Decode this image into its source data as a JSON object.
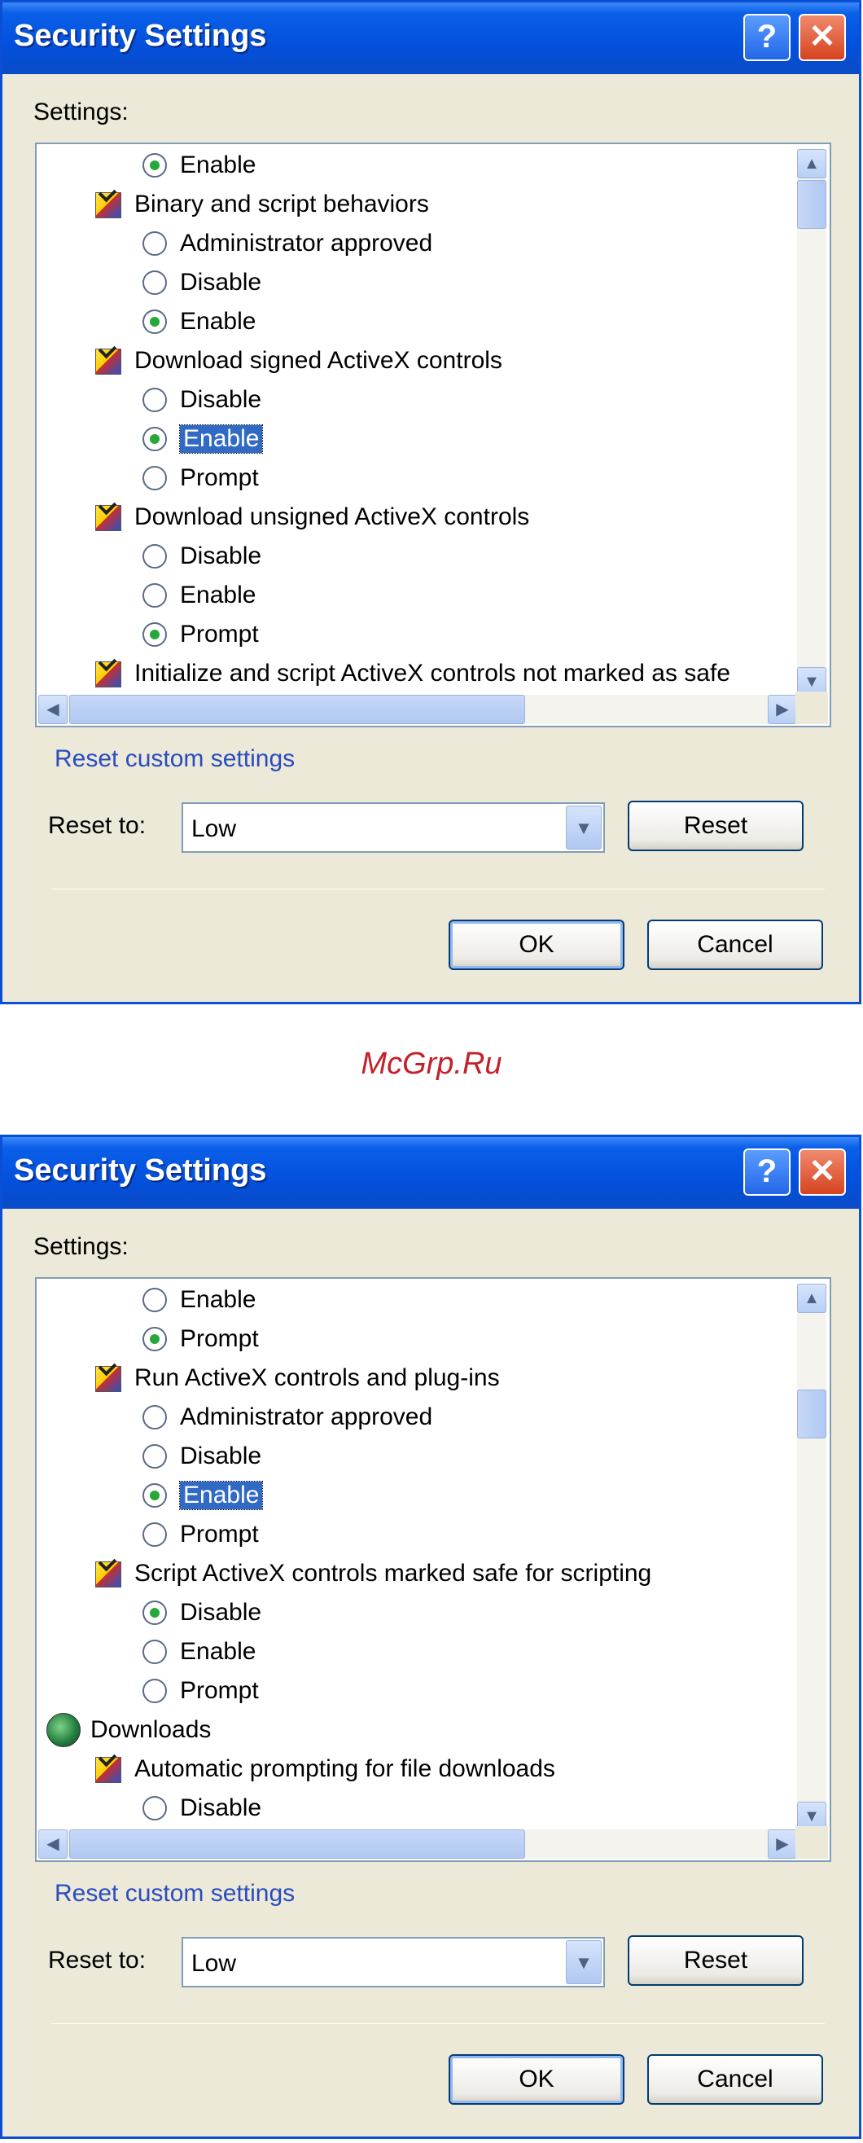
{
  "watermark": "McGrp.Ru",
  "dialogs": [
    {
      "title": "Security Settings",
      "help_label": "?",
      "close_label": "✕",
      "settings_label": "Settings:",
      "list_items": [
        {
          "kind": "radio",
          "label": "Enable",
          "checked": true,
          "selected": false
        },
        {
          "kind": "group",
          "icon": "settings-check-icon",
          "label": "Binary and script behaviors"
        },
        {
          "kind": "radio",
          "label": "Administrator approved",
          "checked": false,
          "selected": false
        },
        {
          "kind": "radio",
          "label": "Disable",
          "checked": false,
          "selected": false
        },
        {
          "kind": "radio",
          "label": "Enable",
          "checked": true,
          "selected": false
        },
        {
          "kind": "group",
          "icon": "settings-check-icon",
          "label": "Download signed ActiveX controls"
        },
        {
          "kind": "radio",
          "label": "Disable",
          "checked": false,
          "selected": false
        },
        {
          "kind": "radio",
          "label": "Enable",
          "checked": true,
          "selected": true
        },
        {
          "kind": "radio",
          "label": "Prompt",
          "checked": false,
          "selected": false
        },
        {
          "kind": "group",
          "icon": "settings-check-icon",
          "label": "Download unsigned ActiveX controls"
        },
        {
          "kind": "radio",
          "label": "Disable",
          "checked": false,
          "selected": false
        },
        {
          "kind": "radio",
          "label": "Enable",
          "checked": false,
          "selected": false
        },
        {
          "kind": "radio",
          "label": "Prompt",
          "checked": true,
          "selected": false
        },
        {
          "kind": "group",
          "icon": "settings-check-icon",
          "label": "Initialize and script ActiveX controls not marked as safe"
        }
      ],
      "reset_custom_label": "Reset custom settings",
      "reset_to_label": "Reset to:",
      "reset_to_value": "Low",
      "reset_button": "Reset",
      "ok_button": "OK",
      "cancel_button": "Cancel"
    },
    {
      "title": "Security Settings",
      "help_label": "?",
      "close_label": "✕",
      "settings_label": "Settings:",
      "list_items": [
        {
          "kind": "radio",
          "label": "Enable",
          "checked": false,
          "selected": false
        },
        {
          "kind": "radio",
          "label": "Prompt",
          "checked": true,
          "selected": false
        },
        {
          "kind": "group",
          "icon": "settings-check-icon",
          "label": "Run ActiveX controls and plug-ins"
        },
        {
          "kind": "radio",
          "label": "Administrator approved",
          "checked": false,
          "selected": false
        },
        {
          "kind": "radio",
          "label": "Disable",
          "checked": false,
          "selected": false
        },
        {
          "kind": "radio",
          "label": "Enable",
          "checked": true,
          "selected": true
        },
        {
          "kind": "radio",
          "label": "Prompt",
          "checked": false,
          "selected": false
        },
        {
          "kind": "group",
          "icon": "settings-check-icon",
          "label": "Script ActiveX controls marked safe for scripting"
        },
        {
          "kind": "radio",
          "label": "Disable",
          "checked": true,
          "selected": false
        },
        {
          "kind": "radio",
          "label": "Enable",
          "checked": false,
          "selected": false
        },
        {
          "kind": "radio",
          "label": "Prompt",
          "checked": false,
          "selected": false
        },
        {
          "kind": "category",
          "icon": "downloads-icon",
          "label": "Downloads"
        },
        {
          "kind": "group",
          "icon": "settings-check-icon",
          "label": "Automatic prompting for file downloads"
        },
        {
          "kind": "radio",
          "label": "Disable",
          "checked": false,
          "selected": false
        }
      ],
      "reset_custom_label": "Reset custom settings",
      "reset_to_label": "Reset to:",
      "reset_to_value": "Low",
      "reset_button": "Reset",
      "ok_button": "OK",
      "cancel_button": "Cancel"
    }
  ]
}
